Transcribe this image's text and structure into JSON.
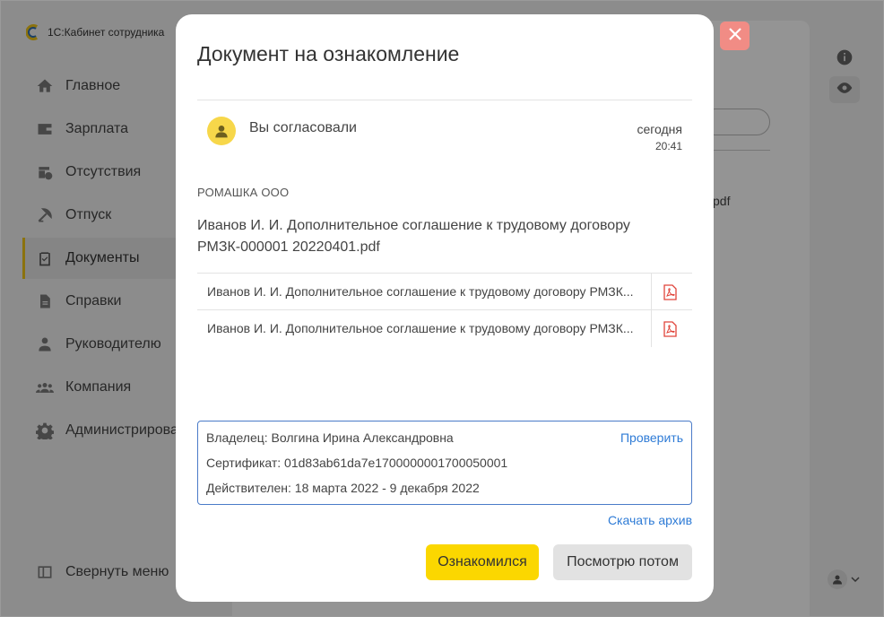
{
  "app": {
    "name": "1С:Кабинет сотрудника"
  },
  "sidebar": {
    "items": [
      {
        "label": "Главное",
        "icon": "home-icon"
      },
      {
        "label": "Зарплата",
        "icon": "wallet-icon"
      },
      {
        "label": "Отсутствия",
        "icon": "calendar-clock-icon"
      },
      {
        "label": "Отпуск",
        "icon": "beach-umbrella-icon"
      },
      {
        "label": "Документы",
        "icon": "clipboard-icon",
        "active": true
      },
      {
        "label": "Справки",
        "icon": "file-icon"
      },
      {
        "label": "Руководителю",
        "icon": "manager-icon"
      },
      {
        "label": "Компания",
        "icon": "group-icon"
      },
      {
        "label": "Администрирова",
        "icon": "gear-icon"
      }
    ],
    "collapse_label": "Свернуть меню"
  },
  "background": {
    "partial_file_text": "pdf"
  },
  "dialog": {
    "title": "Документ на ознакомление",
    "status": {
      "text": "Вы согласовали",
      "date": "сегодня",
      "time": "20:41"
    },
    "organization": "РОМАШКА ООО",
    "document_title": "Иванов И. И. Дополнительное соглашение к трудовому договору РМЗК-000001 20220401.pdf",
    "files": [
      {
        "name": "Иванов И. И. Дополнительное соглашение к трудовому договору РМЗК..."
      },
      {
        "name": "Иванов И. И. Дополнительное соглашение к трудовому договору РМЗК..."
      }
    ],
    "certificate": {
      "owner": "Владелец: Волгина Ирина Александровна",
      "cert": "Сертификат: 01d83ab61da7e1700000001700050001",
      "valid": "Действителен: 18 марта 2022 - 9 декабря 2022",
      "check_link": "Проверить"
    },
    "download_archive": "Скачать архив",
    "primary_button": "Ознакомился",
    "secondary_button": "Посмотрю потом"
  },
  "colors": {
    "accent_yellow": "#fbd700",
    "link_blue": "#2e7bd6",
    "close_red": "#f18c85",
    "pdf_red": "#e0443a"
  }
}
